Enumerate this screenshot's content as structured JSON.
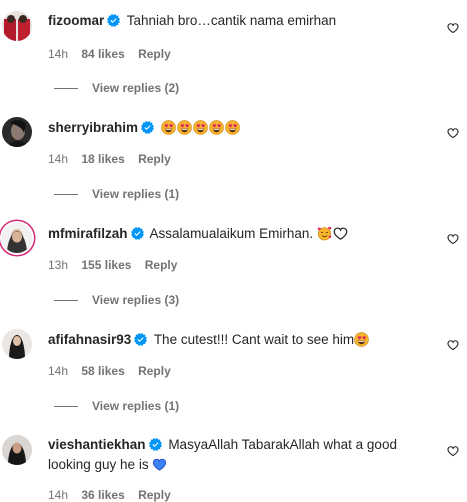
{
  "comments": [
    {
      "username": "fizoomar",
      "text": "Tahniah bro…cantik nama emirhan",
      "time": "14h",
      "likes": "84 likes",
      "reply": "Reply",
      "view_replies": "View replies (2)"
    },
    {
      "username": "sherryibrahim",
      "text": "",
      "time": "14h",
      "likes": "18 likes",
      "reply": "Reply",
      "view_replies": "View replies (1)"
    },
    {
      "username": "mfmirafilzah",
      "text": "Assalamualaikum Emirhan.",
      "time": "13h",
      "likes": "155 likes",
      "reply": "Reply",
      "view_replies": "View replies (3)"
    },
    {
      "username": "afifahnasir93",
      "text": "The cutest!!! Cant wait to see him",
      "time": "14h",
      "likes": "58 likes",
      "reply": "Reply",
      "view_replies": "View replies (1)"
    },
    {
      "username": "vieshantiekhan",
      "text": "MasyaAllah TabarakAllah what a good looking guy he is",
      "time": "14h",
      "likes": "36 likes",
      "reply": "Reply"
    }
  ],
  "colors": {
    "verified": "#0095f6",
    "secondary_text": "#737373",
    "primary_text": "#262626",
    "blue_heart": "#3b82f6"
  },
  "icons": {
    "verified": "verified-badge-icon",
    "like": "heart-outline-icon",
    "emoji_heart_eyes": "heart-eyes-emoji",
    "emoji_hearts_face": "smiling-face-with-hearts-emoji",
    "emoji_white_heart": "white-heart-emoji",
    "emoji_blue_heart": "blue-heart-emoji"
  }
}
